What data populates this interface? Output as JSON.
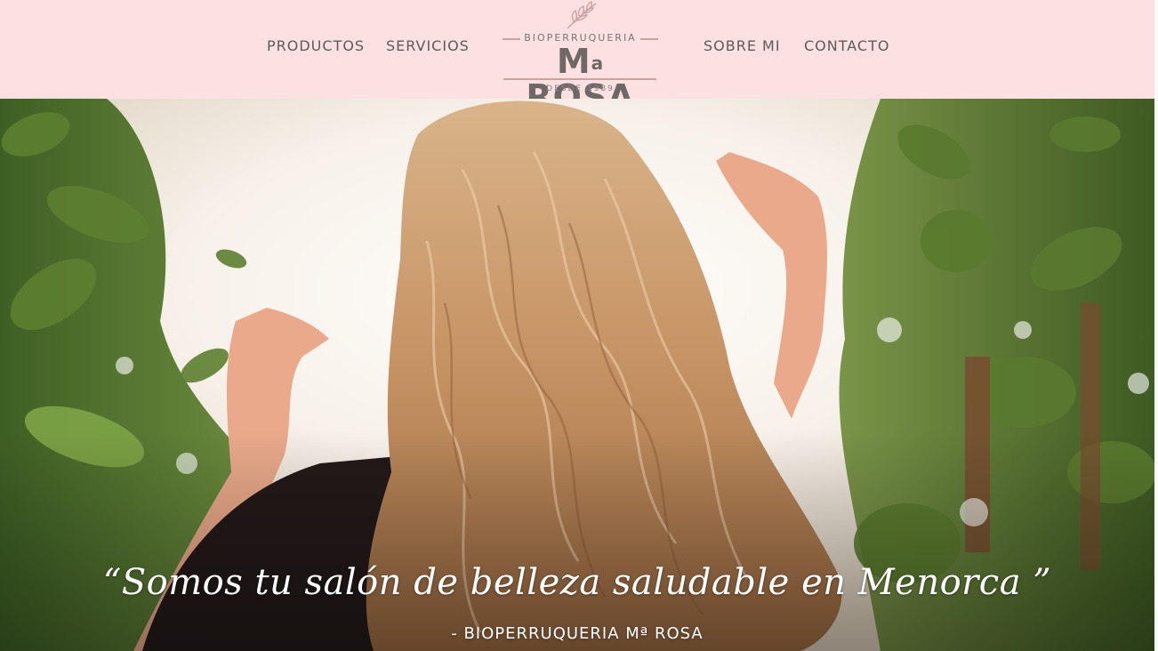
{
  "nav": {
    "productos": "PRODUCTOS",
    "servicios": "SERVICIOS",
    "sobre_mi": "SOBRE MI",
    "contacto": "CONTACTO"
  },
  "logo": {
    "top_text": "BIOPERRUQUERIA",
    "main_text": "M",
    "main_sup": "a",
    "main_rest": " ROSA",
    "since": "DESDE 1989",
    "icon": "leaf-branch-icon"
  },
  "hero": {
    "quote": "“Somos tu salón de belleza saludable en Menorca ”",
    "attribution": "- BIOPERRUQUERIA Mª ROSA"
  },
  "colors": {
    "header_bg": "#fce0e2",
    "nav_text": "#5e5a58",
    "accent": "#c9a3a0"
  }
}
